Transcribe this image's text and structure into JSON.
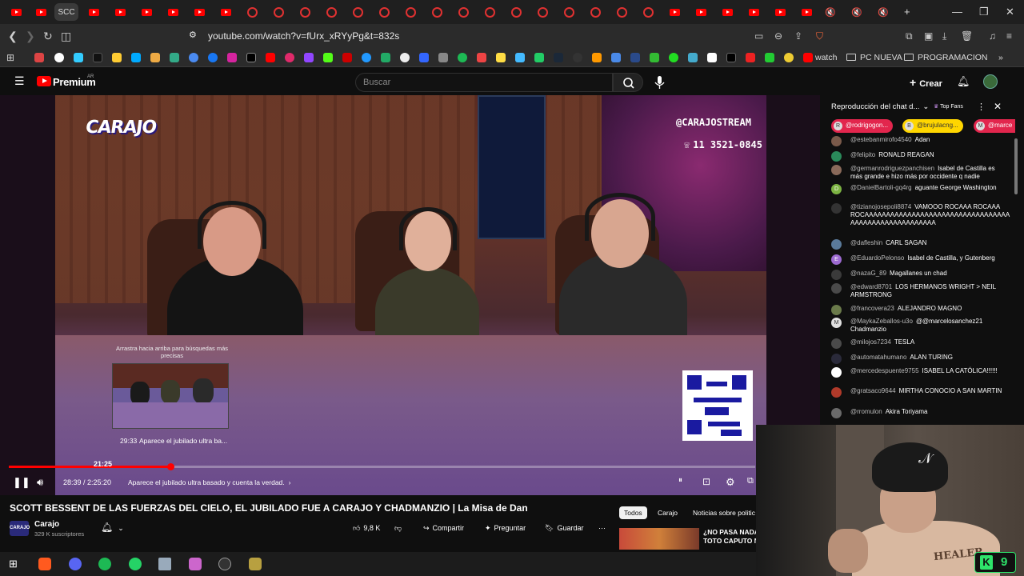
{
  "browser": {
    "active_tab_label": "SCC",
    "url": "youtube.com/watch?v=fUrx_xRYyPg&t=832s",
    "bookmarks": {
      "watch_label": "watch",
      "folder1": "PC NUEVA",
      "folder2": "PROGRAMACION"
    }
  },
  "youtube": {
    "logo_text": "Premium",
    "logo_sup": "AR",
    "search_placeholder": "Buscar",
    "create_label": "Crear"
  },
  "video": {
    "overlay_logo": "CARAJO",
    "handle": "@CARAJOSTREAM",
    "phone": "11 3521-0845",
    "hover_hint": "Arrastra hacia arriba para búsquedas más precisas",
    "preview_time": "29:33",
    "preview_title": "Aparece el jubilado ultra ba...",
    "progress_tip": "21:25",
    "progress_fraction": 0.217,
    "current_time": "28:39 / 2:25:20",
    "chapter": "Aparece el jubilado ultra basado y cuenta la verdad.",
    "title": "SCOTT BESSENT DE LAS FUERZAS DEL CIELO, EL JUBILADO FUE A CARAJO Y CHADMANZIO | La Misa de Dan"
  },
  "channel": {
    "avatar_text": "CARAJO",
    "name": "Carajo",
    "subs": "329 K suscriptores"
  },
  "actions": {
    "likes": "9,8 K",
    "share": "Compartir",
    "ask": "Preguntar",
    "save": "Guardar"
  },
  "chips": {
    "all": "Todos",
    "carajo": "Carajo",
    "news": "Noticias sobre politic"
  },
  "recommended": {
    "title_line1": "¿NO PASA NADA",
    "title_line2": "TOTO CAPUTO N"
  },
  "chat": {
    "header": "Reproducción del chat d...",
    "top_fans": "Top Fans",
    "pills": [
      {
        "initial": "R",
        "name": "@rodrigogon..."
      },
      {
        "initial": "B",
        "name": "@brujulacng..."
      },
      {
        "initial": "M",
        "name": "@marce"
      }
    ],
    "messages": [
      {
        "user": "@estebanmirofo4540",
        "text": "Adan",
        "color": "#7a5a4a",
        "initial": ""
      },
      {
        "user": "@felipito",
        "text": "RONALD REAGAN",
        "color": "#2a8a5a",
        "initial": ""
      },
      {
        "user": "@germanrodriguezpanchisen",
        "text": "Isabel de Castilla es más grande e hizo más por occidente q nadie",
        "color": "#8a6a5a",
        "initial": ""
      },
      {
        "user": "@DanielBartoli-gq4rg",
        "text": "aguante George Washington",
        "color": "#7cb342",
        "initial": "D"
      },
      {
        "user": "@tizianojosepoli8874",
        "text": "VAMOOO ROCAAA ROCAAA ROCAAAAAAAAAAAAAAAAAAAAAAAAAAAAAAAAAA AAAAAAAAAAAAAAAAAAAA",
        "color": "#333",
        "initial": ""
      },
      {
        "user": "@dafleshin",
        "text": "CARL SAGAN",
        "color": "#5a7a9a",
        "initial": ""
      },
      {
        "user": "@EduardoPelonso",
        "text": "Isabel de Castilla, y Gutenberg",
        "color": "#9c6ad0",
        "initial": "E"
      },
      {
        "user": "@nazaG_89",
        "text": "Magallanes un chad",
        "color": "#3a3a3a",
        "initial": ""
      },
      {
        "user": "@edward8701",
        "text": "LOS HERMANOS WRIGHT > NEIL ARMSTRONG",
        "color": "#4a4a4a",
        "initial": ""
      },
      {
        "user": "@francovera23",
        "text": "ALEJANDRO MAGNO",
        "color": "#6a7a4a",
        "initial": ""
      },
      {
        "user": "@MaykaZeballos-u3o",
        "text": "@@marcelosanchez21 Chadmanzio",
        "color": "#e0e0e0",
        "initial": "M"
      },
      {
        "user": "@milojos7234",
        "text": "TESLA",
        "color": "#4a4a4a",
        "initial": ""
      },
      {
        "user": "@automatahumano",
        "text": "ALAN TURING",
        "color": "#2a2a3a",
        "initial": ""
      },
      {
        "user": "@mercedespuente9755",
        "text": "ISABEL LA CATÓLICA!!!!!!",
        "color": "#ffffff",
        "initial": ""
      },
      {
        "user": "@gratsaco9644",
        "text": "MIRTHA CONOCIO A SAN MARTIN",
        "color": "#b03a2a",
        "initial": ""
      },
      {
        "user": "@rromulon",
        "text": "Akira Toriyama",
        "color": "#6a6a6a",
        "initial": ""
      }
    ]
  },
  "webcam": {
    "shirt_text": "HEALER",
    "badge_letter": "K",
    "badge_count": "9"
  },
  "colors": {
    "yt_red": "#ff0000",
    "bg": "#0f0f0f",
    "kick_green": "#2ee36a"
  }
}
